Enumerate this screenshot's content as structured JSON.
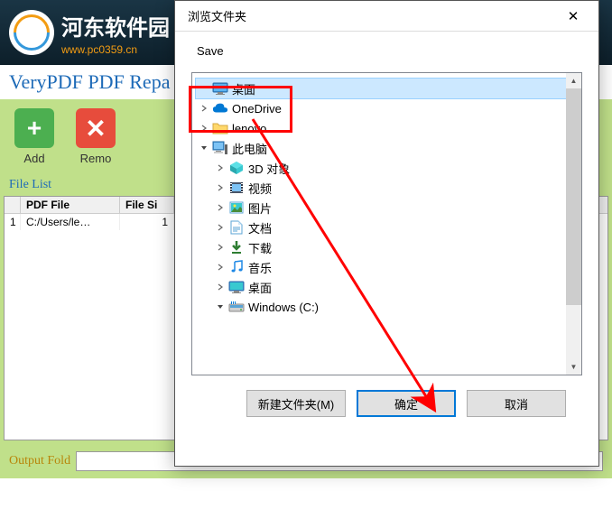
{
  "watermark": {
    "text": "河东软件园",
    "url": "www.pc0359.cn"
  },
  "app": {
    "title": "VeryPDF PDF Repa",
    "toolbar": {
      "add_label": "Add",
      "remove_label": "Remo"
    },
    "filelist_label": "File List",
    "table": {
      "headers": [
        "",
        "PDF File",
        "File Si"
      ],
      "rows": [
        {
          "num": "1",
          "file": "C:/Users/le…",
          "size": "1"
        }
      ]
    },
    "output_label": "Output Fold",
    "output_value": ""
  },
  "dialog": {
    "title": "浏览文件夹",
    "description": "Save",
    "tree": [
      {
        "level": 0,
        "exp": "",
        "icon": "monitor",
        "label": "桌面",
        "selected": true
      },
      {
        "level": 0,
        "exp": ">",
        "icon": "cloud",
        "label": "OneDrive"
      },
      {
        "level": 0,
        "exp": ">",
        "icon": "folder",
        "label": "lenovo"
      },
      {
        "level": 0,
        "exp": "v",
        "icon": "pc",
        "label": "此电脑"
      },
      {
        "level": 1,
        "exp": ">",
        "icon": "box3d",
        "label": "3D 对象"
      },
      {
        "level": 1,
        "exp": ">",
        "icon": "film",
        "label": "视频"
      },
      {
        "level": 1,
        "exp": ">",
        "icon": "img",
        "label": "图片"
      },
      {
        "level": 1,
        "exp": ">",
        "icon": "doc",
        "label": "文档"
      },
      {
        "level": 1,
        "exp": ">",
        "icon": "down",
        "label": "下载"
      },
      {
        "level": 1,
        "exp": ">",
        "icon": "music",
        "label": "音乐"
      },
      {
        "level": 1,
        "exp": ">",
        "icon": "desk",
        "label": "桌面"
      },
      {
        "level": 1,
        "exp": "v",
        "icon": "drive",
        "label": "Windows (C:)"
      }
    ],
    "btn_newfolder": "新建文件夹(M)",
    "btn_ok": "确定",
    "btn_cancel": "取消"
  }
}
